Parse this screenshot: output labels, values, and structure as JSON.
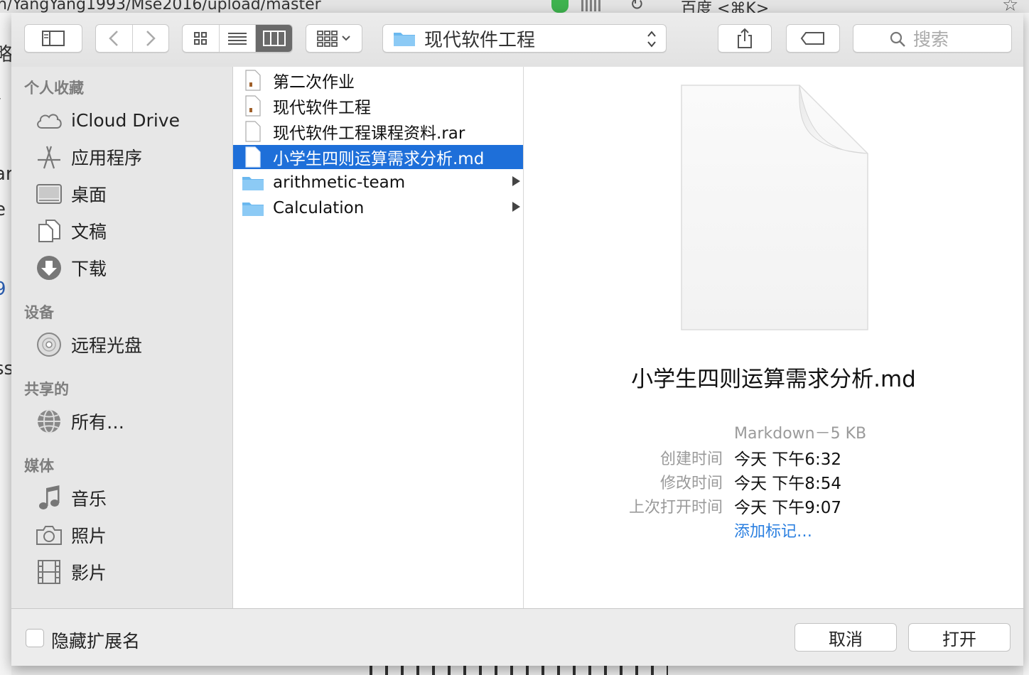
{
  "background": {
    "url_text": "n/YangYang1993/Mse2016/upload/master",
    "search_text": "百度 <⌘K>",
    "left_fragments": [
      "略",
      "/",
      "ar",
      "e",
      "9",
      "ss"
    ]
  },
  "toolbar": {
    "sidebar_toggle_icon": "sidebar-icon",
    "back_icon": "chevron-left-icon",
    "forward_icon": "chevron-right-icon",
    "view_icons": [
      "grid-icon",
      "list-icon",
      "columns-icon"
    ],
    "active_view": "columns",
    "group_icon": "group-icon",
    "location": "现代软件工程",
    "share_icon": "share-icon",
    "tag_icon": "tag-icon",
    "search_placeholder": "搜索"
  },
  "sidebar": {
    "sections": [
      {
        "header": "个人收藏",
        "items": [
          {
            "label": "iCloud Drive",
            "icon": "cloud-icon"
          },
          {
            "label": "应用程序",
            "icon": "applications-icon"
          },
          {
            "label": "桌面",
            "icon": "desktop-icon"
          },
          {
            "label": "文稿",
            "icon": "documents-icon"
          },
          {
            "label": "下载",
            "icon": "download-icon"
          }
        ]
      },
      {
        "header": "设备",
        "items": [
          {
            "label": "远程光盘",
            "icon": "disc-icon"
          }
        ]
      },
      {
        "header": "共享的",
        "items": [
          {
            "label": "所有…",
            "icon": "network-icon"
          }
        ]
      },
      {
        "header": "媒体",
        "items": [
          {
            "label": "音乐",
            "icon": "music-icon"
          },
          {
            "label": "照片",
            "icon": "camera-icon"
          },
          {
            "label": "影片",
            "icon": "film-icon"
          }
        ]
      }
    ]
  },
  "files": [
    {
      "name": "第二次作业",
      "type": "doc",
      "selected": false
    },
    {
      "name": "现代软件工程",
      "type": "doc",
      "selected": false
    },
    {
      "name": "现代软件工程课程资料.rar",
      "type": "file",
      "selected": false
    },
    {
      "name": "小学生四则运算需求分析.md",
      "type": "file",
      "selected": true
    },
    {
      "name": "arithmetic-team",
      "type": "folder",
      "selected": false
    },
    {
      "name": "Calculation",
      "type": "folder",
      "selected": false
    }
  ],
  "preview": {
    "name": "小学生四则运算需求分析.md",
    "kind_size": "Markdown－5 KB",
    "meta": [
      {
        "key": "创建时间",
        "value": "今天 下午6:32"
      },
      {
        "key": "修改时间",
        "value": "今天 下午8:54"
      },
      {
        "key": "上次打开时间",
        "value": "今天 下午9:07"
      }
    ],
    "add_tag": "添加标记…"
  },
  "footer": {
    "hide_extension_label": "隐藏扩展名",
    "hide_extension_checked": false,
    "cancel_label": "取消",
    "open_label": "打开"
  },
  "colors": {
    "selection": "#1e6fd9",
    "folder": "#6ab8ef",
    "link": "#2a7fe0"
  }
}
